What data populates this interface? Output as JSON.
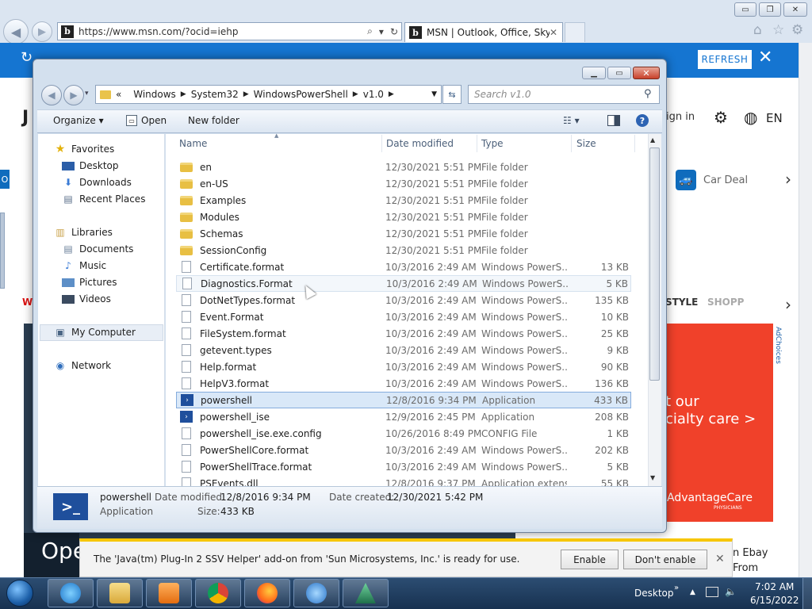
{
  "browser": {
    "url": "https://www.msn.com/?ocid=iehp",
    "tab_title": "MSN | Outlook, Office, Sky...",
    "tab_close": "✕",
    "window_min": "▭",
    "window_max": "❐",
    "window_close": "✕"
  },
  "msn": {
    "refresh_label": "REFRESH",
    "notify_close": "✕",
    "sign_in": "ign in",
    "lang": "EN",
    "car_deals": "Car Deal",
    "nav_style": "STYLE",
    "nav_shopping": "SHOPP",
    "ad_line1": "t our",
    "ad_line2": "cialty care >",
    "ad_brand": "AdvantageCare",
    "ad_sub": "PHYSICIANS",
    "adchoices": "AdChoices",
    "promo_text": "Ope",
    "side_text1": "n Ebay",
    "side_text2": "From",
    "left_w": "W",
    "left_o": "O",
    "left_j": "J"
  },
  "dialog": {
    "breadcrumb": [
      "«",
      "Windows",
      "System32",
      "WindowsPowerShell",
      "v1.0"
    ],
    "search_placeholder": "Search v1.0",
    "toolbar": {
      "organize": "Organize ▾",
      "open": "Open",
      "new_folder": "New folder"
    },
    "nav": {
      "favorites": "Favorites",
      "desktop": "Desktop",
      "downloads": "Downloads",
      "recent": "Recent Places",
      "libraries": "Libraries",
      "documents": "Documents",
      "music": "Music",
      "pictures": "Pictures",
      "videos": "Videos",
      "computer": "My Computer",
      "network": "Network"
    },
    "columns": {
      "name": "Name",
      "date": "Date modified",
      "type": "Type",
      "size": "Size"
    },
    "files": [
      {
        "name": "en",
        "date": "12/30/2021 5:51 PM",
        "type": "File folder",
        "size": "",
        "kind": "folder"
      },
      {
        "name": "en-US",
        "date": "12/30/2021 5:51 PM",
        "type": "File folder",
        "size": "",
        "kind": "folder"
      },
      {
        "name": "Examples",
        "date": "12/30/2021 5:51 PM",
        "type": "File folder",
        "size": "",
        "kind": "folder"
      },
      {
        "name": "Modules",
        "date": "12/30/2021 5:51 PM",
        "type": "File folder",
        "size": "",
        "kind": "folder"
      },
      {
        "name": "Schemas",
        "date": "12/30/2021 5:51 PM",
        "type": "File folder",
        "size": "",
        "kind": "folder"
      },
      {
        "name": "SessionConfig",
        "date": "12/30/2021 5:51 PM",
        "type": "File folder",
        "size": "",
        "kind": "folder"
      },
      {
        "name": "Certificate.format",
        "date": "10/3/2016 2:49 AM",
        "type": "Windows PowerS...",
        "size": "13 KB",
        "kind": "file"
      },
      {
        "name": "Diagnostics.Format",
        "date": "10/3/2016 2:49 AM",
        "type": "Windows PowerS...",
        "size": "5 KB",
        "kind": "file"
      },
      {
        "name": "DotNetTypes.format",
        "date": "10/3/2016 2:49 AM",
        "type": "Windows PowerS...",
        "size": "135 KB",
        "kind": "file"
      },
      {
        "name": "Event.Format",
        "date": "10/3/2016 2:49 AM",
        "type": "Windows PowerS...",
        "size": "10 KB",
        "kind": "file"
      },
      {
        "name": "FileSystem.format",
        "date": "10/3/2016 2:49 AM",
        "type": "Windows PowerS...",
        "size": "25 KB",
        "kind": "file"
      },
      {
        "name": "getevent.types",
        "date": "10/3/2016 2:49 AM",
        "type": "Windows PowerS...",
        "size": "9 KB",
        "kind": "file"
      },
      {
        "name": "Help.format",
        "date": "10/3/2016 2:49 AM",
        "type": "Windows PowerS...",
        "size": "90 KB",
        "kind": "file"
      },
      {
        "name": "HelpV3.format",
        "date": "10/3/2016 2:49 AM",
        "type": "Windows PowerS...",
        "size": "136 KB",
        "kind": "file"
      },
      {
        "name": "powershell",
        "date": "12/8/2016 9:34 PM",
        "type": "Application",
        "size": "433 KB",
        "kind": "ps"
      },
      {
        "name": "powershell_ise",
        "date": "12/9/2016 2:45 PM",
        "type": "Application",
        "size": "208 KB",
        "kind": "ps"
      },
      {
        "name": "powershell_ise.exe.config",
        "date": "10/26/2016 8:49 PM",
        "type": "CONFIG File",
        "size": "1 KB",
        "kind": "file"
      },
      {
        "name": "PowerShellCore.format",
        "date": "10/3/2016 2:49 AM",
        "type": "Windows PowerS...",
        "size": "202 KB",
        "kind": "file"
      },
      {
        "name": "PowerShellTrace.format",
        "date": "10/3/2016 2:49 AM",
        "type": "Windows PowerS...",
        "size": "5 KB",
        "kind": "file"
      },
      {
        "name": "PSEvents.dll",
        "date": "12/8/2016 9:37 PM",
        "type": "Application extens...",
        "size": "55 KB",
        "kind": "file"
      }
    ],
    "details": {
      "name": "powershell",
      "type": "Application",
      "modified_label": "Date modified:",
      "modified": "12/8/2016 9:34 PM",
      "size_label": "Size:",
      "size": "433 KB",
      "created_label": "Date created:",
      "created": "12/30/2021 5:42 PM"
    }
  },
  "java_bar": {
    "message": "The 'Java(tm) Plug-In 2 SSV Helper' add-on from 'Sun Microsystems, Inc.' is ready for use.",
    "enable": "Enable",
    "dont_enable": "Don't enable",
    "close": "✕"
  },
  "taskbar": {
    "desktop_label": "Desktop",
    "time": "7:02 AM",
    "date": "6/15/2022"
  },
  "colors": {
    "msn_blue": "#1575d1",
    "ad_red": "#f0412a",
    "selection": "#d9e8f8",
    "java_bar_accent": "#f7c600"
  },
  "icons": {
    "powershell": "powershell-icon",
    "folder": "folder-icon",
    "file": "file-icon"
  }
}
